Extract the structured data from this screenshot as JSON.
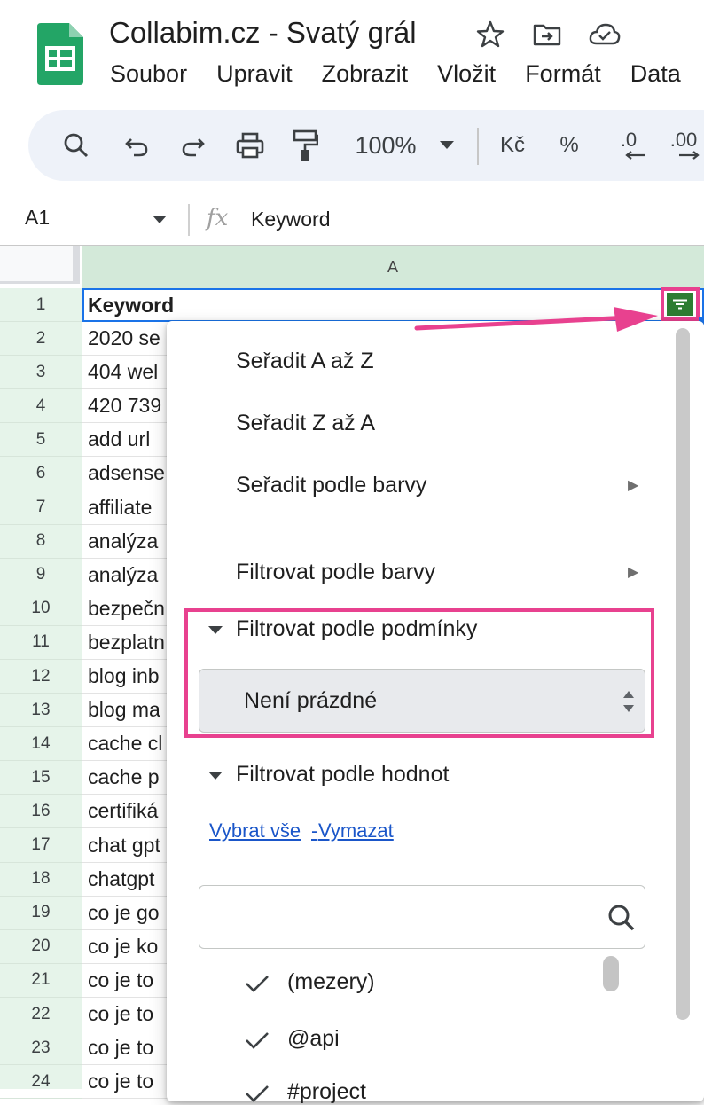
{
  "app": {
    "title": "Collabim.cz - Svatý grál",
    "header_icons": [
      "star-icon",
      "move-to-folder-icon",
      "cloud-saved-icon"
    ],
    "menu": [
      "Soubor",
      "Upravit",
      "Zobrazit",
      "Vložit",
      "Formát",
      "Data"
    ]
  },
  "toolbar": {
    "zoom": "100%",
    "currency": "Kč",
    "percent": "%",
    "decrease_decimals": ".0",
    "increase_decimals": ".00",
    "icons": [
      "search-icon",
      "undo-icon",
      "redo-icon",
      "print-icon",
      "paint-format-icon",
      "zoom-dropdown-icon",
      "decrease-decimals-icon",
      "increase-decimals-icon"
    ]
  },
  "formula_bar": {
    "cell_ref": "A1",
    "fx": "fx",
    "value": "Keyword"
  },
  "grid": {
    "column": "A",
    "rows": [
      {
        "n": "1",
        "v": "Keyword"
      },
      {
        "n": "2",
        "v": "2020 se"
      },
      {
        "n": "3",
        "v": "404 wel"
      },
      {
        "n": "4",
        "v": "420 739"
      },
      {
        "n": "5",
        "v": "add url"
      },
      {
        "n": "6",
        "v": "adsense"
      },
      {
        "n": "7",
        "v": "affiliate"
      },
      {
        "n": "8",
        "v": "analýza"
      },
      {
        "n": "9",
        "v": "analýza"
      },
      {
        "n": "10",
        "v": "bezpečn"
      },
      {
        "n": "11",
        "v": "bezplatn"
      },
      {
        "n": "12",
        "v": "blog inb"
      },
      {
        "n": "13",
        "v": "blog ma"
      },
      {
        "n": "14",
        "v": "cache cl"
      },
      {
        "n": "15",
        "v": "cache p"
      },
      {
        "n": "16",
        "v": "certifiká"
      },
      {
        "n": "17",
        "v": "chat gpt"
      },
      {
        "n": "18",
        "v": "chatgpt"
      },
      {
        "n": "19",
        "v": "co je go"
      },
      {
        "n": "20",
        "v": "co je ko"
      },
      {
        "n": "21",
        "v": "co je to"
      },
      {
        "n": "22",
        "v": "co je to"
      },
      {
        "n": "23",
        "v": "co je to"
      },
      {
        "n": "24",
        "v": "co je to"
      }
    ]
  },
  "filter_menu": {
    "sort_az": "Seřadit A až Z",
    "sort_za": "Seřadit Z až A",
    "sort_by_color": "Seřadit podle barvy",
    "filter_by_color": "Filtrovat podle barvy",
    "filter_by_condition": "Filtrovat podle podmínky",
    "condition_value": "Není prázdné",
    "filter_by_values": "Filtrovat podle hodnot",
    "select_all": "Vybrat vše",
    "link_separator": "-",
    "clear": "Vymazat",
    "search_placeholder": "",
    "values": [
      {
        "label": "(mezery)",
        "checked": true
      },
      {
        "label": "@api",
        "checked": true
      },
      {
        "label": "#project",
        "checked": true
      }
    ]
  },
  "colors": {
    "annotation": "#e8418f",
    "filter_active": "#2e7d32",
    "selection": "#1a73e8",
    "column_header_selected": "#d3e9d9",
    "link": "#1a56c9"
  }
}
